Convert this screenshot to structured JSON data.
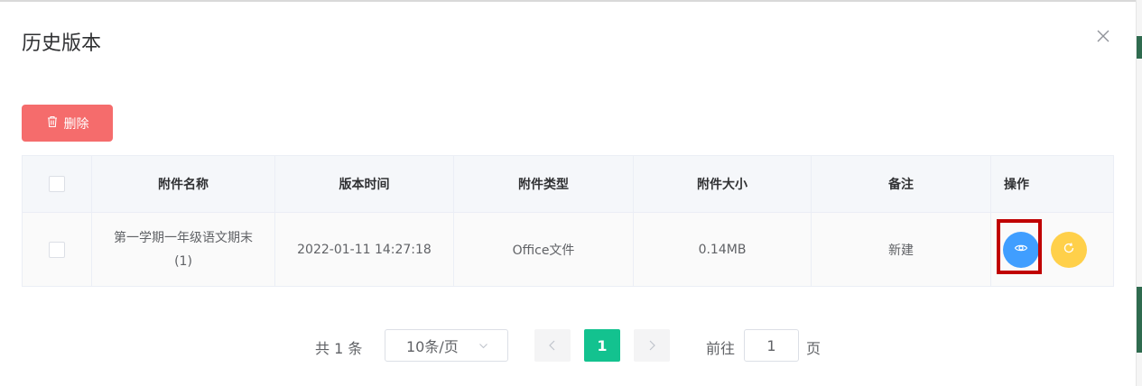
{
  "dialog": {
    "title": "历史版本",
    "delete_label": "删除"
  },
  "table": {
    "columns": [
      "附件名称",
      "版本时间",
      "附件类型",
      "附件大小",
      "备注",
      "操作"
    ],
    "rows": [
      {
        "name": "第一学期一年级语文期末(1)",
        "version_time": "2022-01-11 14:27:18",
        "type": "Office文件",
        "size": "0.14MB",
        "remark": "新建"
      }
    ]
  },
  "pagination": {
    "total_label": "共 1 条",
    "page_size": "10条/页",
    "current_page": "1",
    "goto_prefix": "前往",
    "goto_value": "1",
    "goto_suffix": "页"
  },
  "colors": {
    "danger": "#f56c6c",
    "primary": "#409eff",
    "warning": "#ffd04a",
    "active_page": "#13c28f",
    "highlight": "#c00000"
  },
  "icons": {
    "close": "close-icon",
    "delete": "trash-icon",
    "view": "eye-icon",
    "restore": "refresh-icon",
    "select": "chevron-down-icon",
    "prev": "chevron-left-icon",
    "next": "chevron-right-icon"
  }
}
